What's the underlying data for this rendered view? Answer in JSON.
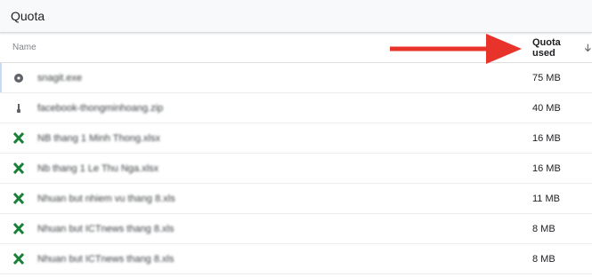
{
  "topbar": {
    "title": "Quota"
  },
  "table": {
    "name_header": "Name",
    "quota_header": "Quota used",
    "sort_icon": "arrow-down-icon",
    "rows": [
      {
        "name": "snagit.exe",
        "size": "75 MB",
        "icon": "app-icon",
        "color": "#5f6368"
      },
      {
        "name": "facebook-thongminhoang.zip",
        "size": "40 MB",
        "icon": "zip-icon",
        "color": "#5f6368"
      },
      {
        "name": "NB thang 1 Minh Thong.xlsx",
        "size": "16 MB",
        "icon": "spreadsheet-icon",
        "color": "#188038"
      },
      {
        "name": "Nb thang 1 Le Thu Nga.xlsx",
        "size": "16 MB",
        "icon": "spreadsheet-icon",
        "color": "#188038"
      },
      {
        "name": "Nhuan but nhiem vu thang 8.xls",
        "size": "11 MB",
        "icon": "spreadsheet-icon",
        "color": "#188038"
      },
      {
        "name": "Nhuan but ICTnews thang 8.xls",
        "size": "8 MB",
        "icon": "spreadsheet-icon",
        "color": "#188038"
      },
      {
        "name": "Nhuan but ICTnews thang 8.xls",
        "size": "8 MB",
        "icon": "spreadsheet-icon",
        "color": "#188038"
      }
    ]
  },
  "annotation": {
    "arrow_color": "#e8332a"
  }
}
